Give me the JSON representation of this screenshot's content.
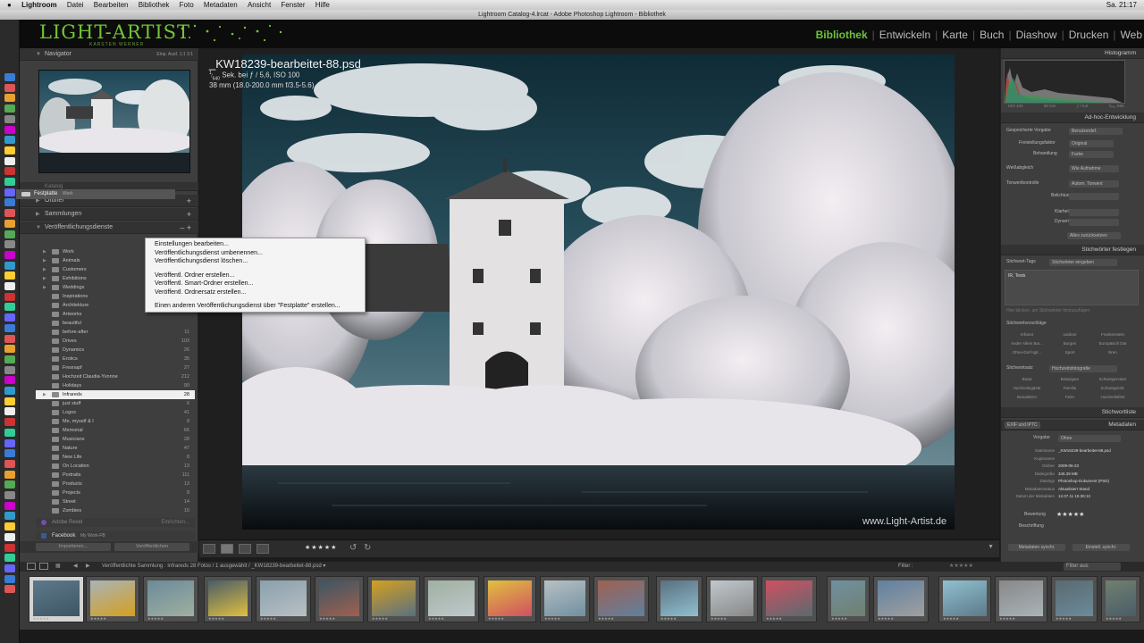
{
  "menubar": {
    "apple": "",
    "app": "Lightroom",
    "items": [
      "Datei",
      "Bearbeiten",
      "Bibliothek",
      "Foto",
      "Metadaten",
      "Ansicht",
      "Fenster",
      "Hilfe"
    ],
    "clock": "Sa. 21:17"
  },
  "window_title": "Lightroom Catalog-4.lrcat - Adobe Photoshop Lightroom - Bibliothek",
  "identity": {
    "logo": "LIGHT-ARTIST",
    "sub": "KARSTEN WERNER"
  },
  "modules": [
    {
      "label": "Bibliothek",
      "active": true
    },
    {
      "label": "Entwickeln"
    },
    {
      "label": "Karte"
    },
    {
      "label": "Buch"
    },
    {
      "label": "Diashow"
    },
    {
      "label": "Drucken"
    },
    {
      "label": "Web"
    }
  ],
  "left": {
    "navigator": {
      "label": "Navigator",
      "zoom_opts": "Einp.  Ausf.  1:1  3:1"
    },
    "katalog": "Katalog",
    "ordner": "Ordner",
    "sammlungen": "Sammlungen",
    "publish": "Veröffentlichungsdienste",
    "festplatte": {
      "label": "Festplatte",
      "sub": "Werk"
    },
    "collections": [
      {
        "name": "Work",
        "count": ""
      },
      {
        "name": "Animals",
        "count": ""
      },
      {
        "name": "Customers",
        "count": ""
      },
      {
        "name": "Exhibitions",
        "count": ""
      },
      {
        "name": "Weddings",
        "count": ""
      },
      {
        "name": "Inspirations",
        "count": ""
      },
      {
        "name": "Architekture",
        "count": ""
      },
      {
        "name": "Artworks",
        "count": ""
      },
      {
        "name": "beautiful",
        "count": ""
      },
      {
        "name": "before-after",
        "count": "11"
      },
      {
        "name": "Drives",
        "count": "103"
      },
      {
        "name": "Dynamics",
        "count": "26"
      },
      {
        "name": "Erotics",
        "count": "35"
      },
      {
        "name": "Fresnapf",
        "count": "27"
      },
      {
        "name": "Hochzeit Claudia-Yvonne",
        "count": "212"
      },
      {
        "name": "Holidays",
        "count": "90"
      },
      {
        "name": "Infrareds",
        "count": "28"
      },
      {
        "name": "just stuff",
        "count": "6"
      },
      {
        "name": "Logos",
        "count": "41"
      },
      {
        "name": "Me, myself & I",
        "count": "8"
      },
      {
        "name": "Memorial",
        "count": "66"
      },
      {
        "name": "Musicians",
        "count": "28"
      },
      {
        "name": "Nature",
        "count": "47"
      },
      {
        "name": "New Life",
        "count": "8"
      },
      {
        "name": "On Location",
        "count": "13"
      },
      {
        "name": "Portraits",
        "count": "111"
      },
      {
        "name": "Products",
        "count": "13"
      },
      {
        "name": "Projects",
        "count": "8"
      },
      {
        "name": "Street",
        "count": "14"
      },
      {
        "name": "Zombies",
        "count": "15"
      }
    ],
    "adobe_revel": {
      "label": "Adobe Revel",
      "action": "Einrichten..."
    },
    "facebook": {
      "label": "Facebook",
      "sub": "My Work-FB"
    },
    "import_btn": "Importieren...",
    "export_btn": "Veröffentlichen"
  },
  "context_menu": [
    "Einstellungen bearbeiten...",
    "Veröffentlichungsdienst umbenennen...",
    "Veröffentlichungsdienst löschen...",
    "",
    "Veröffentl. Ordner erstellen...",
    "Veröffentl. Smart-Ordner erstellen...",
    "Veröffentl. Ordnersatz erstellen...",
    "",
    "Einen anderen Veröffentlichungsdienst über \"Festplatte\" erstellen..."
  ],
  "photo": {
    "title": "_KW18239-bearbeitet-88.psd",
    "exposure_num": "1",
    "exposure_den": "640",
    "exposure_rest": " Sek. bei ƒ / 5,6, ISO 100",
    "lens": "38 mm (18.0-200.0 mm f/3.5-5.6)",
    "watermark": "www.Light-Artist.de"
  },
  "toolbar": {
    "stars": "★★★★★"
  },
  "right": {
    "histogram": "Histogramm",
    "histo_info": [
      "ISO 100",
      "38 mm",
      "ƒ / 5,6",
      "¹⁄₆₄₀ Sek."
    ],
    "adhoc": "Ad-hoc-Entwicklung",
    "gespeicherte": "Gespeicherte Vorgabe",
    "gespeicherte_val": "Benutzerdef.",
    "freistellung": "Freistellungsfaktor",
    "freistellung_val": "Original",
    "behandlung": "Behandlung",
    "behandlung_val": "Farbe",
    "weiss": "Weißabgleich",
    "weiss_val": "Wie Aufnahme",
    "ton": "Tonwertkontrolle",
    "ton_val": "Autom. Tonwert",
    "belichtung": "Belichtung",
    "klarheit": "Klarheit",
    "dynamik": "Dynamik",
    "reset": "Alles zurücksetzen",
    "kw_festlegen": "Stichwörter festlegen",
    "kw_tags": "Stichwort-Tags",
    "kw_tags_val": "Stichwörter eingeben",
    "kw_current": "IR, Tests",
    "kw_hint": "Hier klicken, um Stichwörter hinzuzufügen",
    "kw_vorschlaege": "Stichwortvorschläge",
    "suggest": [
      "Infrarot",
      "outdoor",
      "Frankenstein",
      "Ander Allem Bur...",
      "Burgen",
      "Europäisch Dat",
      "Ohne-Dorf-Igit...",
      "Sport",
      "Bren"
    ],
    "kw_satz": "Stichwortsatz",
    "kw_satz_val": "Hochzeitsfotografie",
    "satz": [
      "Braut",
      "Bräutigam",
      "Schwiegervater",
      "Hochzeitsgäste",
      "Familie",
      "Schwiegerelt.",
      "Brauteltern",
      "Feier",
      "Hochzeitsfest"
    ],
    "kw_liste": "Stichwortliste",
    "metadaten": "Metadaten",
    "exif": "EXIF und IPTC",
    "vorgabe": "Vorgabe",
    "vorgabe_val": "Ohne",
    "meta": [
      {
        "k": "Dateiname",
        "v": "_KW18239-bearbeitet-88.psd"
      },
      {
        "k": "Kopiename",
        "v": ""
      },
      {
        "k": "Ordner",
        "v": "2009-06-23"
      },
      {
        "k": "Dateigröße",
        "v": "346.39 MB"
      },
      {
        "k": "Dateityp",
        "v": "Photoshop-Dokument (PSD)"
      },
      {
        "k": "Metadatenstatus",
        "v": "Aktualisiert Stand"
      },
      {
        "k": "Datum der Metadaten",
        "v": "12.07.11 15:36:12"
      }
    ],
    "bewertung": "Bewertung",
    "bewertung_val": "★★★★★",
    "beschriftung": "Beschriftung",
    "sync_btn": "Metadaten synchr.",
    "sync2_btn": "Einstell. synchr."
  },
  "filmbar": {
    "path": "Veröffentlichte Sammlung : Infrareds  28 Fotos /  1 ausgewählt / _KW18239-bearbeitet-88.psd ▾",
    "filter_label": "Filter :",
    "filter_val": "Filter aus"
  }
}
